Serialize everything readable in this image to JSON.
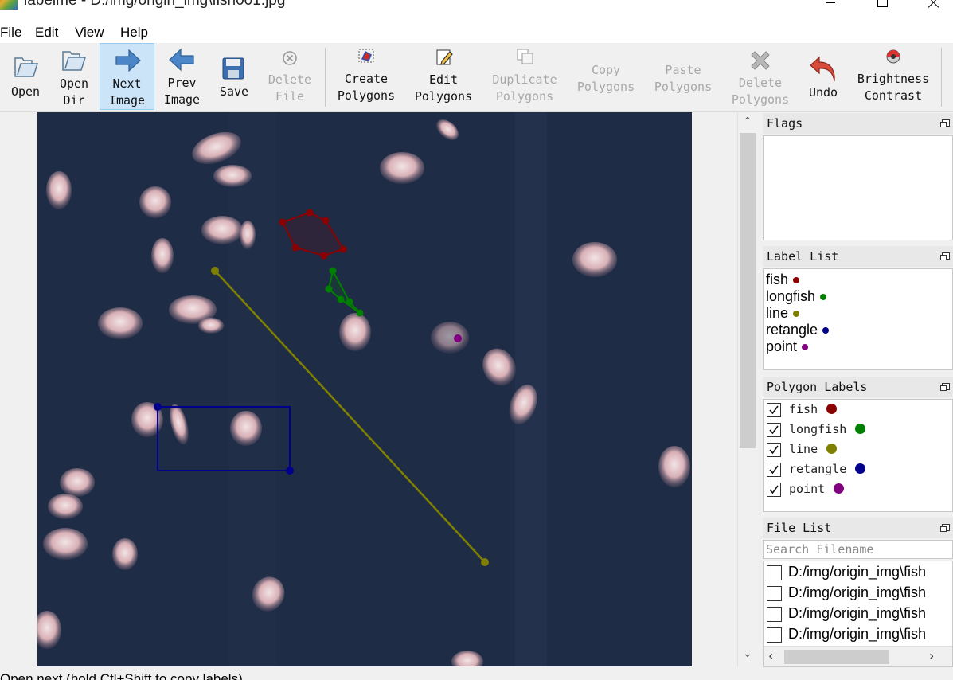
{
  "window": {
    "title": "labelme - D:/img/origin_img\\fish001.jpg*"
  },
  "menu": [
    "File",
    "Edit",
    "View",
    "Help"
  ],
  "toolbar": {
    "open": "Open",
    "open_dir": "Open\nDir",
    "next_image": "Next\nImage",
    "prev_image": "Prev\nImage",
    "save": "Save",
    "delete_file": "Delete\nFile",
    "create_polygons": "Create\nPolygons",
    "edit_polygons": "Edit\nPolygons",
    "duplicate_polygons": "Duplicate\nPolygons",
    "copy_polygons": "Copy\nPolygons",
    "paste_polygons": "Paste\nPolygons",
    "delete_polygons": "Delete\nPolygons",
    "undo": "Undo",
    "brightness_contrast": "Brightness\nContrast"
  },
  "canvas": {
    "shapes": [
      {
        "label": "fish",
        "type": "polygon",
        "color": "#8b0000"
      },
      {
        "label": "longfish",
        "type": "linestrip",
        "color": "#008000"
      },
      {
        "label": "line",
        "type": "line",
        "color": "#808000"
      },
      {
        "label": "retangle",
        "type": "rectangle",
        "color": "#00008b"
      },
      {
        "label": "point",
        "type": "point",
        "color": "#800080"
      }
    ]
  },
  "flags": {
    "title": "Flags"
  },
  "label_list": {
    "title": "Label List",
    "items": [
      {
        "text": "fish",
        "color": "#8b0000"
      },
      {
        "text": "longfish",
        "color": "#008000"
      },
      {
        "text": "line",
        "color": "#808000"
      },
      {
        "text": "retangle",
        "color": "#00008b"
      },
      {
        "text": "point",
        "color": "#800080"
      }
    ]
  },
  "polygon_labels": {
    "title": "Polygon Labels",
    "items": [
      {
        "text": "fish",
        "checked": true,
        "color": "#8b0000"
      },
      {
        "text": "longfish",
        "checked": true,
        "color": "#008000"
      },
      {
        "text": "line",
        "checked": true,
        "color": "#808000"
      },
      {
        "text": "retangle",
        "checked": true,
        "color": "#00008b"
      },
      {
        "text": "point",
        "checked": true,
        "color": "#800080"
      }
    ]
  },
  "file_list": {
    "title": "File List",
    "search_placeholder": "Search Filename",
    "items": [
      "D:/img/origin_img\\fish",
      "D:/img/origin_img\\fish",
      "D:/img/origin_img\\fish",
      "D:/img/origin_img\\fish"
    ]
  },
  "status": "Open next (hold Ctl+Shift to copy labels)"
}
